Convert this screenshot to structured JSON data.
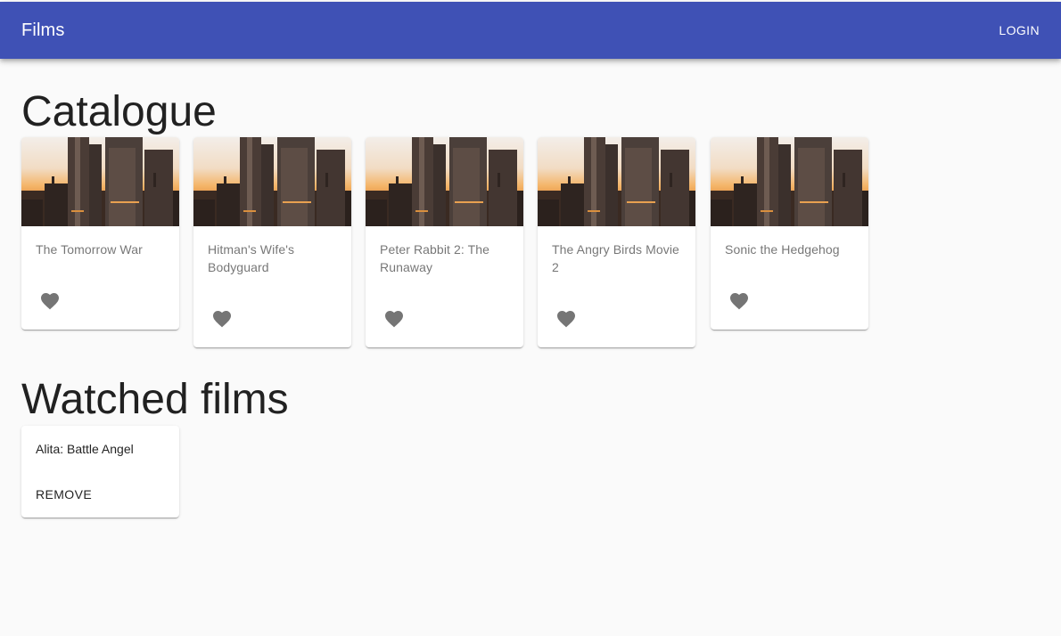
{
  "app_bar": {
    "title": "Films",
    "login_label": "LOGIN",
    "color": "#3f51b5"
  },
  "catalogue": {
    "heading": "Catalogue",
    "films": [
      {
        "title": "The Tomorrow War",
        "image": "city-skyline-sunset",
        "icon": "heart-icon"
      },
      {
        "title": "Hitman's Wife's Bodyguard",
        "image": "city-skyline-sunset",
        "icon": "heart-icon"
      },
      {
        "title": "Peter Rabbit 2: The Runaway",
        "image": "city-skyline-sunset",
        "icon": "heart-icon"
      },
      {
        "title": "The Angry Birds Movie 2",
        "image": "city-skyline-sunset",
        "icon": "heart-icon"
      },
      {
        "title": "Sonic the Hedgehog",
        "image": "city-skyline-sunset",
        "icon": "heart-icon"
      }
    ]
  },
  "watched": {
    "heading": "Watched films",
    "films": [
      {
        "title": "Alita: Battle Angel",
        "remove_label": "REMOVE"
      }
    ]
  }
}
